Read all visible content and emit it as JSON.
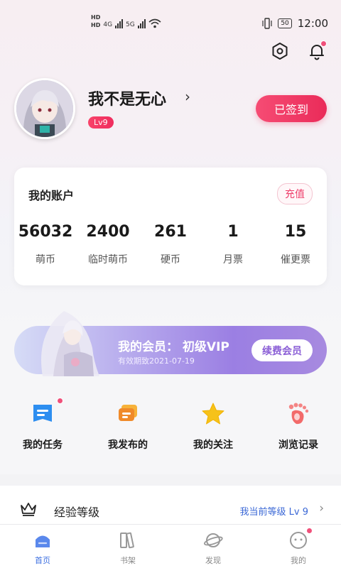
{
  "status_bar": {
    "hd_top": "HD",
    "hd_bottom": "HD",
    "net1": "4G",
    "net2": "5G",
    "battery": "50",
    "time": "12:00"
  },
  "header": {
    "settings_icon": "hexagon-settings-icon",
    "notification_icon": "bell-icon"
  },
  "profile": {
    "nickname": "我不是无心",
    "level": "Lv9",
    "checkin_label": "已签到"
  },
  "account": {
    "title": "我的账户",
    "recharge_label": "充值",
    "stats": [
      {
        "value": "56032",
        "label": "萌币"
      },
      {
        "value": "2400",
        "label": "临时萌币"
      },
      {
        "value": "261",
        "label": "硬币"
      },
      {
        "value": "1",
        "label": "月票"
      },
      {
        "value": "15",
        "label": "催更票"
      }
    ]
  },
  "vip": {
    "title": "我的会员：  初级VIP",
    "expiry": "有效期致2021-07-19",
    "renew_label": "续费会员"
  },
  "quick_actions": [
    {
      "label": "我的任务",
      "icon": "task-list-icon"
    },
    {
      "label": "我发布的",
      "icon": "chat-publish-icon"
    },
    {
      "label": "我的关注",
      "icon": "star-icon"
    },
    {
      "label": "浏览记录",
      "icon": "footprint-icon"
    }
  ],
  "experience": {
    "title": "经验等级",
    "current_level": "我当前等级 Lv 9",
    "icon": "crown-icon"
  },
  "tabs": [
    {
      "label": "首页",
      "icon": "home-icon",
      "active": true
    },
    {
      "label": "书架",
      "icon": "bookshelf-icon",
      "active": false
    },
    {
      "label": "发现",
      "icon": "planet-icon",
      "active": false
    },
    {
      "label": "我的",
      "icon": "smile-face-icon",
      "active": false
    }
  ],
  "colors": {
    "accent": "#ee3d6a",
    "tab_active": "#3d6fe0",
    "vip_purple": "#9b7fe3"
  }
}
